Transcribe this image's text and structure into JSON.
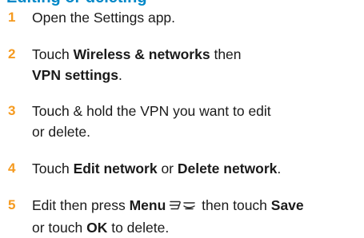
{
  "heading_fragment": "Editing or deleting a VPN",
  "steps": [
    {
      "number": "1",
      "parts": [
        {
          "text": "Open the Settings app.",
          "bold": false
        }
      ]
    },
    {
      "number": "2",
      "parts": [
        {
          "text": "Touch ",
          "bold": false
        },
        {
          "text": "Wireless & networks",
          "bold": true
        },
        {
          "text": " then",
          "bold": false
        },
        {
          "text": "VPN settings",
          "bold": true
        },
        {
          "text": ".",
          "bold": false
        }
      ]
    },
    {
      "number": "3",
      "parts": [
        {
          "text": "Touch & hold the VPN you want to edit",
          "bold": false
        },
        {
          "text": "or delete.",
          "bold": false
        }
      ]
    },
    {
      "number": "4",
      "parts": [
        {
          "text": "Touch ",
          "bold": false
        },
        {
          "text": "Edit network",
          "bold": true
        },
        {
          "text": " or ",
          "bold": false
        },
        {
          "text": "Delete network",
          "bold": true
        },
        {
          "text": ".",
          "bold": false
        }
      ]
    },
    {
      "number": "5",
      "parts": [
        {
          "text": "Edit then press ",
          "bold": false
        },
        {
          "text": "Menu",
          "bold": true
        },
        {
          "text": " then touch ",
          "bold": false
        },
        {
          "text": "Save",
          "bold": true
        },
        {
          "text": "or touch ",
          "bold": false
        },
        {
          "text": "OK",
          "bold": true
        },
        {
          "text": " to delete.",
          "bold": false
        }
      ]
    }
  ],
  "icons": {
    "menu": "menu-key-icon"
  },
  "colors": {
    "heading": "#0088c8",
    "step_number": "#f59a1f",
    "body_text": "#1a1a1a"
  }
}
